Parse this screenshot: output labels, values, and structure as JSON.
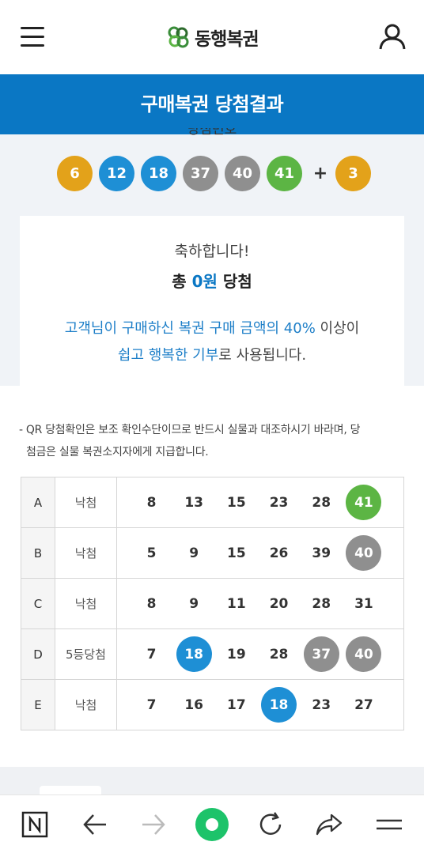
{
  "header": {
    "logo_text": "동행복권",
    "menu_icon": "hamburger-menu-icon",
    "user_icon": "user-icon"
  },
  "title": "구매복권 당첨결과",
  "winning": {
    "label": "당첨번호",
    "numbers": [
      {
        "value": "6",
        "color": "#e3a21a"
      },
      {
        "value": "12",
        "color": "#1e8fd5"
      },
      {
        "value": "18",
        "color": "#1e8fd5"
      },
      {
        "value": "37",
        "color": "#8f8f8f"
      },
      {
        "value": "40",
        "color": "#8f8f8f"
      },
      {
        "value": "41",
        "color": "#5cb544"
      }
    ],
    "plus": "+",
    "bonus": {
      "value": "3",
      "color": "#e3a21a"
    }
  },
  "result_card": {
    "congrats": "축하합니다!",
    "total_prefix": "총",
    "total_amount": "0원",
    "total_suffix": "당첨",
    "msg1_blue": "고객님이 구매하신 복권 구매 금액의 40%",
    "msg1_rest": " 이상이",
    "msg2_blue": "쉽고 행복한 기부",
    "msg2_rest": "로 사용됩니다."
  },
  "notice": {
    "line1": "- QR 당첨확인은 보조 확인수단이므로 반드시 실물과 대조하시기 바라며, 당",
    "line2": "첨금은 실물 복권소지자에게 지급합니다."
  },
  "games": [
    {
      "game": "A",
      "status": "낙첨",
      "numbers": [
        {
          "v": "8",
          "c": ""
        },
        {
          "v": "13",
          "c": ""
        },
        {
          "v": "15",
          "c": ""
        },
        {
          "v": "23",
          "c": ""
        },
        {
          "v": "28",
          "c": ""
        },
        {
          "v": "41",
          "c": "#5cb544"
        }
      ]
    },
    {
      "game": "B",
      "status": "낙첨",
      "numbers": [
        {
          "v": "5",
          "c": ""
        },
        {
          "v": "9",
          "c": ""
        },
        {
          "v": "15",
          "c": ""
        },
        {
          "v": "26",
          "c": ""
        },
        {
          "v": "39",
          "c": ""
        },
        {
          "v": "40",
          "c": "#8f8f8f"
        }
      ]
    },
    {
      "game": "C",
      "status": "낙첨",
      "numbers": [
        {
          "v": "8",
          "c": ""
        },
        {
          "v": "9",
          "c": ""
        },
        {
          "v": "11",
          "c": ""
        },
        {
          "v": "20",
          "c": ""
        },
        {
          "v": "28",
          "c": ""
        },
        {
          "v": "31",
          "c": ""
        }
      ]
    },
    {
      "game": "D",
      "status": "5등당첨",
      "numbers": [
        {
          "v": "7",
          "c": ""
        },
        {
          "v": "18",
          "c": "#1e8fd5"
        },
        {
          "v": "19",
          "c": ""
        },
        {
          "v": "28",
          "c": ""
        },
        {
          "v": "37",
          "c": "#8f8f8f"
        },
        {
          "v": "40",
          "c": "#8f8f8f"
        }
      ]
    },
    {
      "game": "E",
      "status": "낙첨",
      "numbers": [
        {
          "v": "7",
          "c": ""
        },
        {
          "v": "16",
          "c": ""
        },
        {
          "v": "17",
          "c": ""
        },
        {
          "v": "18",
          "c": "#1e8fd5"
        },
        {
          "v": "23",
          "c": ""
        },
        {
          "v": "27",
          "c": ""
        }
      ]
    }
  ],
  "bottom_nav": {
    "items": [
      "naver-home-icon",
      "back-arrow-icon",
      "forward-arrow-icon",
      "green-dot-icon",
      "refresh-icon",
      "share-icon",
      "menu-icon"
    ],
    "accent": "#1dc36a"
  }
}
